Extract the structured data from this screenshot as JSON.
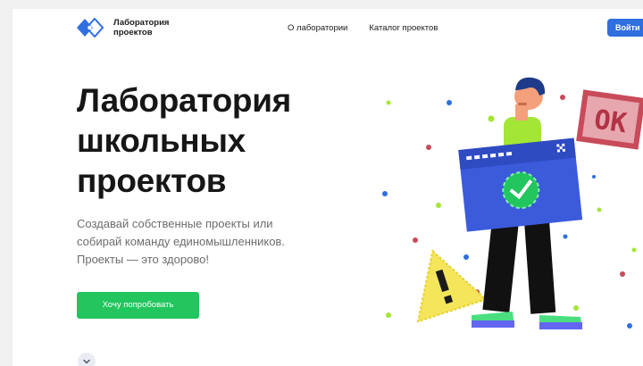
{
  "header": {
    "logo": {
      "line1": "Лаборатория",
      "line2": "проектов"
    },
    "nav": [
      "О лаборатории",
      "Каталог проектов"
    ],
    "login_label": "Войти"
  },
  "hero": {
    "title_lines": [
      "Лаборатория",
      "школьных",
      "проектов"
    ],
    "subtitle_lines": [
      "Создавай собственные проекты или",
      "собирай команду единомышленников.",
      "Проекты — это здорово!"
    ],
    "cta_label": "Хочу попробовать"
  },
  "illustration": {
    "sign_text": "OK",
    "icons": [
      "check-icon",
      "warning-icon",
      "close-icon",
      "chevron-down-icon"
    ]
  },
  "colors": {
    "brand_blue": "#2f6fe0",
    "cta_green": "#22c55e",
    "title": "#161616",
    "subtitle": "#6d6d6d",
    "sign_red": "#c84b5a"
  }
}
